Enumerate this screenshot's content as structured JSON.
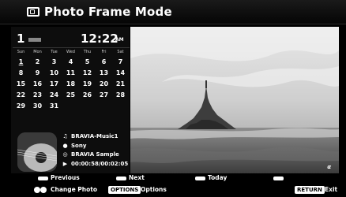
{
  "header": {
    "title": "Photo Frame Mode",
    "icon": "photo-frame-icon"
  },
  "clock": {
    "day": "1",
    "time": "12:22",
    "ampm": "AM"
  },
  "calendar": {
    "weekdays": [
      "Sun",
      "Mon",
      "Tue",
      "Wed",
      "Thu",
      "Fri",
      "Sat"
    ],
    "weeks": [
      [
        "1",
        "2",
        "3",
        "4",
        "5",
        "6",
        "7"
      ],
      [
        "8",
        "9",
        "10",
        "11",
        "12",
        "13",
        "14"
      ],
      [
        "15",
        "16",
        "17",
        "18",
        "19",
        "20",
        "21"
      ],
      [
        "22",
        "23",
        "24",
        "25",
        "26",
        "27",
        "28"
      ],
      [
        "29",
        "30",
        "31",
        "",
        "",
        "",
        ""
      ]
    ],
    "today": "1"
  },
  "music": {
    "track": "BRAVIA-Music1",
    "artist": "Sony",
    "album": "BRAVIA Sample",
    "time": "00:00:58/00:02:05",
    "icons": [
      "music-note-icon",
      "person-icon",
      "disc-icon",
      "play-icon"
    ]
  },
  "photo": {
    "badge": "α"
  },
  "footer": {
    "previous": "Previous",
    "next": "Next",
    "today": "Today",
    "change_photo": "Change Photo",
    "options_key": "OPTIONS",
    "options": "Options",
    "return_key": "RETURN",
    "exit": "Exit"
  }
}
